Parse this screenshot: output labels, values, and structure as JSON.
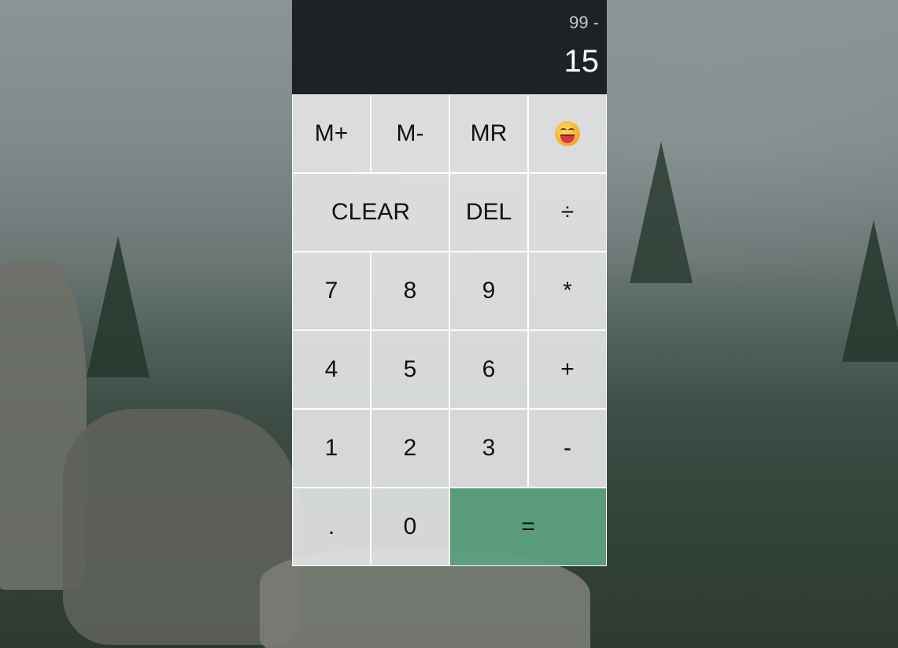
{
  "display": {
    "previous_operand": "99 -",
    "current_operand": "15"
  },
  "keys": {
    "memory_add": "M+",
    "memory_subtract": "M-",
    "memory_recall": "MR",
    "clear": "CLEAR",
    "delete": "DEL",
    "divide": "÷",
    "seven": "7",
    "eight": "8",
    "nine": "9",
    "multiply": "*",
    "four": "4",
    "five": "5",
    "six": "6",
    "plus": "+",
    "one": "1",
    "two": "2",
    "three": "3",
    "minus": "-",
    "decimal": ".",
    "zero": "0",
    "equals": "="
  },
  "icons": {
    "emoji_button": "grinning-face-icon"
  },
  "colors": {
    "display_bg": "#1f2224",
    "key_bg": "#e1e2e4",
    "equals_bg": "#5ca07e"
  }
}
